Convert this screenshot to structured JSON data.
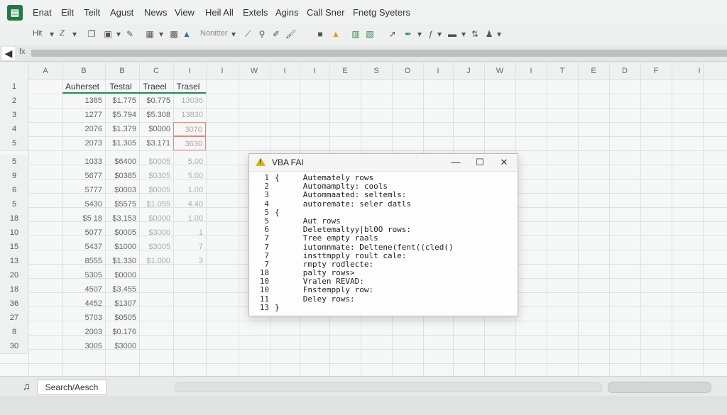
{
  "menu": [
    "Enat",
    "Eilt",
    "Teilt",
    "Agust",
    "News",
    "View",
    "Heil All",
    "Extels",
    "Agins",
    "Call Sner",
    "Fnetg Syeters"
  ],
  "toolbar": {
    "font_label": "Hit",
    "style_label": "Z",
    "dropdown_label": "Nonitter"
  },
  "columns": [
    "A",
    "B",
    "B",
    "C",
    "I",
    "I",
    "W",
    "I",
    "I",
    "E",
    "S",
    "O",
    "I",
    "J",
    "W",
    "I",
    "T",
    "E",
    "D",
    "F",
    "I"
  ],
  "rows": [
    "1",
    "2",
    "3",
    "4",
    "5",
    "5",
    "9",
    "6",
    "5",
    "18",
    "10",
    "15",
    "13",
    "20",
    "18",
    "36",
    "27",
    "8",
    "30"
  ],
  "table": {
    "headers": [
      "Auherset",
      "Testal",
      "Traeel",
      "Trasel"
    ],
    "body": [
      [
        "1385",
        "$1.775",
        "$0.775",
        "13036"
      ],
      [
        "1277",
        "$5.794",
        "$5.308",
        "13830"
      ],
      [
        "2076",
        "$1.379",
        "$0000",
        "3070"
      ],
      [
        "2073",
        "$1.305",
        "$3.171",
        "3630"
      ],
      [
        "1033",
        "$6400",
        "$0005",
        "5.00"
      ],
      [
        "5677",
        "$0385",
        "$0305",
        "5.00"
      ],
      [
        "5777",
        "$0003",
        "$0005",
        "1.00"
      ],
      [
        "5430",
        "$5575",
        "$1.055",
        "4.40"
      ],
      [
        "$5 18",
        "$3.153",
        "$0000",
        "1.00"
      ],
      [
        "5077",
        "$0005",
        "$3000",
        "1"
      ],
      [
        "5437",
        "$1000",
        "$3005",
        "7"
      ],
      [
        "8555",
        "$1.330",
        "$1.000",
        "3"
      ],
      [
        "5305",
        "$0000",
        "",
        ""
      ],
      [
        "4507",
        "$3.455",
        "",
        ""
      ],
      [
        "4452",
        "$1307",
        "",
        ""
      ],
      [
        "5703",
        "$0505",
        "",
        ""
      ],
      [
        "2003",
        "$0.176",
        "",
        ""
      ],
      [
        "3005",
        "$3000",
        "",
        ""
      ]
    ]
  },
  "dialog": {
    "title": "VBA FAI",
    "lines": [
      {
        "n": "1",
        "t": "{     Autemately rows"
      },
      {
        "n": "2",
        "t": "      Automamplty: cools"
      },
      {
        "n": "3",
        "t": "      Autommaated: seltemls:"
      },
      {
        "n": "4",
        "t": "      autoremate: seler datls"
      },
      {
        "n": "5",
        "t": "{"
      },
      {
        "n": "5",
        "t": "      Aut rows"
      },
      {
        "n": "6",
        "t": "      Deletemaltyy|bl0O rows:"
      },
      {
        "n": "7",
        "t": "      Tree empty raals"
      },
      {
        "n": "7",
        "t": "      iutomnmate: Deltene(fent((cled()"
      },
      {
        "n": "7",
        "t": "      insttmpply roult cale:"
      },
      {
        "n": "7",
        "t": "      rmpty rodlecte:"
      },
      {
        "n": "18",
        "t": "      palty rows>"
      },
      {
        "n": "10",
        "t": "      Vralen REVAD:"
      },
      {
        "n": "10",
        "t": "      Fnstempply row:"
      },
      {
        "n": "11",
        "t": "      Deley rows:"
      },
      {
        "n": "13",
        "t": "}"
      }
    ]
  },
  "sheet_tab": "Search/Aesch"
}
